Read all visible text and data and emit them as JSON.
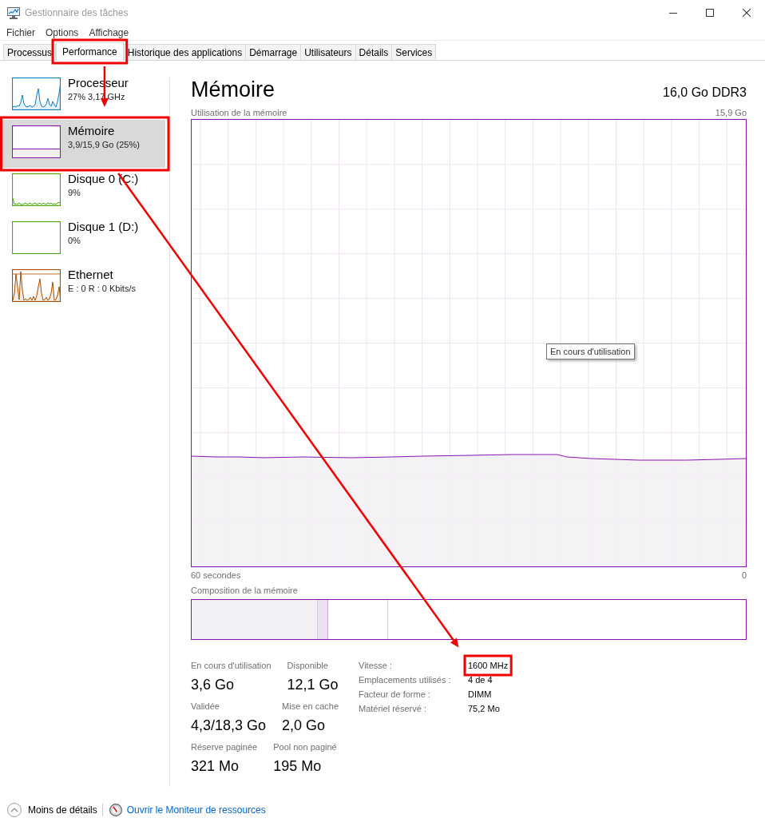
{
  "window": {
    "title": "Gestionnaire des tâches"
  },
  "menu": [
    "Fichier",
    "Options",
    "Affichage"
  ],
  "tabs": [
    {
      "label": "Processus",
      "selected": false,
      "highlighted": false
    },
    {
      "label": "Performance",
      "selected": true,
      "highlighted": true
    },
    {
      "label": "Historique des applications",
      "selected": false,
      "highlighted": false
    },
    {
      "label": "Démarrage",
      "selected": false,
      "highlighted": false
    },
    {
      "label": "Utilisateurs",
      "selected": false,
      "highlighted": false
    },
    {
      "label": "Détails",
      "selected": false,
      "highlighted": false
    },
    {
      "label": "Services",
      "selected": false,
      "highlighted": false
    }
  ],
  "sidebar": {
    "items": [
      {
        "kind": "cpu",
        "title": "Processeur",
        "subtitle": "27% 3,17 GHz",
        "color": "#117dbb",
        "selected": false,
        "highlighted": false
      },
      {
        "kind": "memory",
        "title": "Mémoire",
        "subtitle": "3,9/15,9 Go (25%)",
        "color": "#8b12ae",
        "selected": true,
        "highlighted": true
      },
      {
        "kind": "disk",
        "title": "Disque 0 (C:)",
        "subtitle": "9%",
        "color": "#4da60c",
        "selected": false,
        "highlighted": false
      },
      {
        "kind": "idle",
        "title": "Disque 1 (D:)",
        "subtitle": "0%",
        "color": "#4da60c",
        "selected": false,
        "highlighted": false
      },
      {
        "kind": "network",
        "title": "Ethernet",
        "subtitle": "E : 0 R : 0 Kbits/s",
        "color": "#a74f01",
        "selected": false,
        "highlighted": false
      }
    ]
  },
  "panel": {
    "title": "Mémoire",
    "capacity": "16,0 Go DDR3",
    "graph_label": "Utilisation de la mémoire",
    "graph_max": "15,9 Go",
    "tooltip": "En cours d'utilisation",
    "time_start": "60 secondes",
    "time_end": "0",
    "composition_label": "Composition de la mémoire",
    "stats": [
      [
        {
          "label": "En cours d'utilisation",
          "value": "3,6 Go"
        },
        {
          "label": "Disponible",
          "value": "12,1 Go"
        }
      ],
      [
        {
          "label": "Validée",
          "value": "4,3/18,3 Go"
        },
        {
          "label": "Mise en cache",
          "value": "2,0 Go"
        }
      ],
      [
        {
          "label": "Réserve paginée",
          "value": "321 Mo"
        },
        {
          "label": "Pool non paginé",
          "value": "195 Mo"
        }
      ]
    ],
    "details": [
      {
        "label": "Vitesse :",
        "value": "1600 MHz",
        "highlighted": true
      },
      {
        "label": "Emplacements utilisés :",
        "value": "4 de 4",
        "highlighted": false
      },
      {
        "label": "Facteur de forme :",
        "value": "DIMM",
        "highlighted": false
      },
      {
        "label": "Matériel réservé :",
        "value": "75,2 Mo",
        "highlighted": false
      }
    ]
  },
  "footer": {
    "fewer_details": "Moins de détails",
    "resource_monitor_link": "Ouvrir le Moniteur de ressources"
  },
  "annotations": {
    "connecting_arrows": true
  }
}
